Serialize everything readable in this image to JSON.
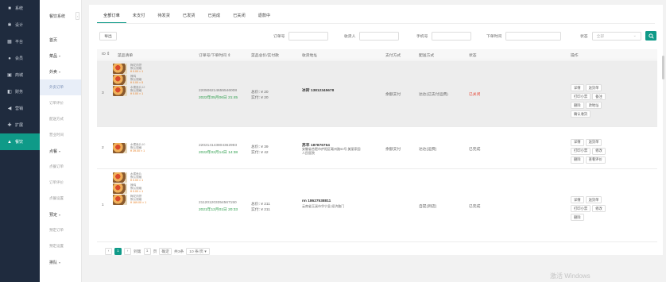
{
  "sidebar": {
    "items": [
      {
        "icon": "■",
        "label": "系统"
      },
      {
        "icon": "✱",
        "label": "设计"
      },
      {
        "icon": "▦",
        "label": "平台"
      },
      {
        "icon": "●",
        "label": "会员"
      },
      {
        "icon": "▣",
        "label": "商城"
      },
      {
        "icon": "◧",
        "label": "财务"
      },
      {
        "icon": "◀",
        "label": "营销"
      },
      {
        "icon": "✚",
        "label": "扩展"
      },
      {
        "icon": "▲",
        "label": "餐饮"
      }
    ]
  },
  "subnav": {
    "title": "餐饮系统",
    "items": [
      {
        "label": "首页",
        "kind": "group"
      },
      {
        "label": "菜品",
        "kind": "group",
        "chev": "▾"
      },
      {
        "label": "外卖",
        "kind": "group",
        "chev": "▾"
      },
      {
        "label": "外卖订单",
        "kind": "active-child"
      },
      {
        "label": "订单评价",
        "kind": "child"
      },
      {
        "label": "配送方式",
        "kind": "child"
      },
      {
        "label": "营业时间",
        "kind": "child"
      },
      {
        "label": "点餐",
        "kind": "group",
        "chev": "▾"
      },
      {
        "label": "点餐订单",
        "kind": "child"
      },
      {
        "label": "订单评价",
        "kind": "child"
      },
      {
        "label": "点餐设置",
        "kind": "child"
      },
      {
        "label": "预定",
        "kind": "group",
        "chev": "▾"
      },
      {
        "label": "预定订单",
        "kind": "child"
      },
      {
        "label": "预定设置",
        "kind": "child"
      },
      {
        "label": "排队",
        "kind": "group",
        "chev": "▾"
      }
    ]
  },
  "tabs": [
    "全部订单",
    "未支付",
    "待发货",
    "已发货",
    "已完成",
    "已关闭",
    "退款中"
  ],
  "toolbar": {
    "export": "导出",
    "order_no_label": "订单号",
    "receiver_label": "收货人",
    "phone_label": "手机号",
    "time_label": "下单时间",
    "status_label": "状态",
    "status_select": "全部"
  },
  "table": {
    "headers": [
      "ID ⇕",
      "菜品清单",
      "订单号/下单时间 ⇕",
      "菜品总价/实付款",
      "收货地址",
      "支付方式",
      "配送方式",
      "状态",
      "操作"
    ]
  },
  "orders": [
    {
      "id": "3",
      "items": [
        {
          "name": "梅花肉饼",
          "spec": "默认规格",
          "price": "¥ 0.00 × 1"
        },
        {
          "name": "辣鸡",
          "spec": "默认规格",
          "price": "¥ 0.00 × 5"
        },
        {
          "name": "水煮鱼片12",
          "spec": "默认规格",
          "price": "¥ 0.00 × 1"
        }
      ],
      "order_no": "220506214655546008",
      "order_time": "2022年05月06日 21:45",
      "total": "总价: ¥ 20",
      "paid": "实付: ¥ 20",
      "address_line1": "冰砖 13812345678",
      "address_line2": "",
      "pay": "余额支付",
      "delivery": "达达(已支付运费)",
      "status": "已关闭",
      "ops": [
        "详情",
        "送货单",
        "打印小票",
        "备注",
        "删除",
        "改地址",
        "确认收货"
      ]
    },
    {
      "id": "2",
      "items": [
        {
          "name": "水煮鱼片10",
          "spec": "默认规格",
          "price": "¥ 39.00 × 1"
        }
      ],
      "order_no": "220214143804362993",
      "order_time": "2022年02月14日 14:38",
      "total": "总价: ¥ 39",
      "paid": "实付: ¥ 42",
      "address_line1": "苏丰 187876764",
      "address_line2": "安徽省合肥市庐阳区亳州路90号 美丽家园",
      "address_line3": "人民医院",
      "pay": "余额支付",
      "delivery": "达达(运费)",
      "status": "已完成",
      "ops": [
        "详情",
        "送货单",
        "打印小票",
        "修改",
        "删除",
        "查看评价"
      ]
    },
    {
      "id": "1",
      "items": [
        {
          "name": "水煮鱼片",
          "spec": "默认规格",
          "price": "¥ 0.00 × 1"
        },
        {
          "name": "辣鸡",
          "spec": "默认规格",
          "price": "¥ 0.00 × 1"
        },
        {
          "name": "梅花肉饼",
          "spec": "默认规格",
          "price": "¥ 169.00 × 1"
        }
      ],
      "order_no": "211201203354567150",
      "order_time": "2021年12月01日 20:33",
      "total": "总价: ¥ 211",
      "paid": "实付: ¥ 211",
      "address_line1": "nn 18627538811",
      "address_line2": "云南省玉溪市华宁县 经济路门",
      "pay": "",
      "delivery": "自提(到店)",
      "status": "已完成",
      "ops": [
        "详情",
        "送货单",
        "打印小票",
        "修改",
        "删除"
      ]
    }
  ],
  "pager": {
    "prev": "‹",
    "page": "1",
    "next": "›",
    "goto_label": "到第",
    "goto_value": "1",
    "unit": "页",
    "confirm": "确定",
    "total": "共3条",
    "per_page": "10 条/页 ▾"
  },
  "watermark": "激活 Windows"
}
